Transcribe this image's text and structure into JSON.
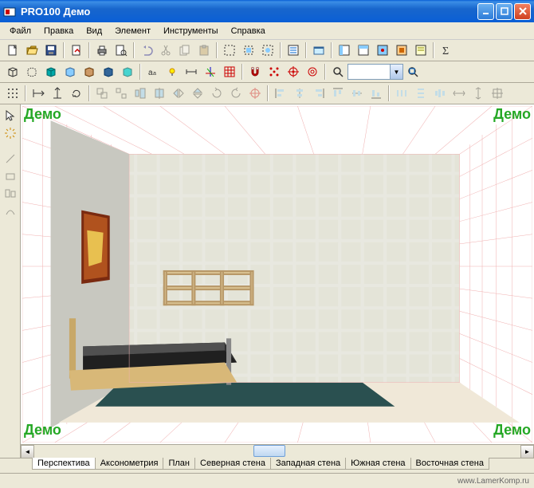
{
  "window": {
    "title": "PRO100 Демо"
  },
  "menu": [
    "Файл",
    "Правка",
    "Вид",
    "Элемент",
    "Инструменты",
    "Справка"
  ],
  "watermark": "Демо",
  "tabs": [
    "Перспектива",
    "Аксонометрия",
    "План",
    "Северная стена",
    "Западная стена",
    "Южная стена",
    "Восточная стена"
  ],
  "zoom": "",
  "status": "www.LamerKomp.ru",
  "icons": {
    "new": "new-file",
    "open": "open",
    "save": "save",
    "import": "import",
    "print": "print",
    "preview": "preview",
    "undo": "undo",
    "cut": "cut",
    "copy": "copy",
    "paste": "paste",
    "sel1": "select",
    "sel2": "select-all",
    "sel3": "select-box",
    "prop": "properties",
    "vis": "visibility",
    "w1": "win1",
    "w2": "win2",
    "w3": "win3",
    "w4": "win4",
    "sigma": "sigma",
    "cube": "cube",
    "text": "text",
    "bulb": "bulb",
    "dim": "dimension",
    "arrows": "arrows",
    "gridred": "grid",
    "magnet": "magnet",
    "tgt1": "target1",
    "tgt2": "target2",
    "zoom": "zoom",
    "zfit": "zoom-fit"
  }
}
